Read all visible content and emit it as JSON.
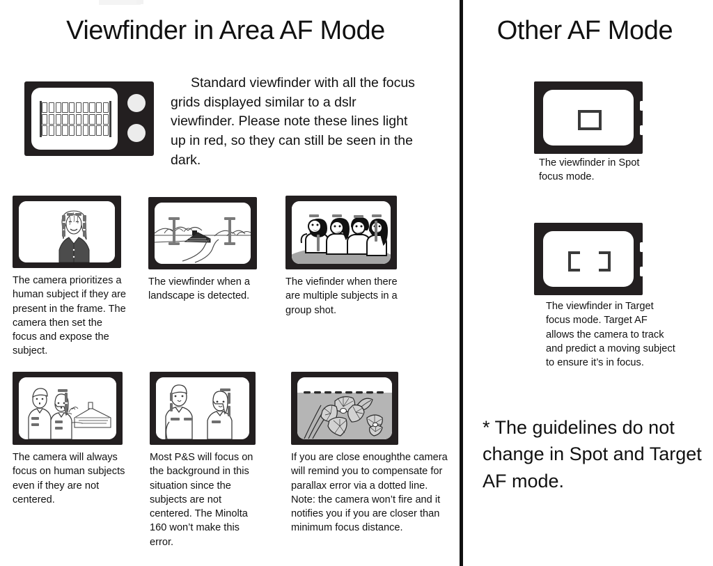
{
  "document": {
    "left_column": {
      "title": "Viewfinder in Area AF Mode",
      "intro_paragraph": "Standard viewfinder with all the focus grids displayed similar to a dslr viewfinder. Please note these lines light up in red, so they can still be seen in the dark.",
      "camera_graphic": {
        "name": "camera-lcd-with-focus-grid",
        "grid_columns": 10,
        "grid_rows": 3,
        "body_color": "#231f20",
        "screen_color": "#ffffff",
        "grid_line_color": "#4a4a4a"
      },
      "examples": [
        {
          "id": "portrait",
          "scene": "single-human-subject-portrait",
          "caption": "The camera prioritizes a human subject if they are present in the frame. The camera then set the focus and expose the subject."
        },
        {
          "id": "landscape",
          "scene": "landscape-with-hills-house-and-road",
          "caption": "The viewfinder when a landscape is detected."
        },
        {
          "id": "group",
          "scene": "group-of-four-people",
          "caption": "The viefinder when there are multiple subjects in a group shot."
        },
        {
          "id": "offcenter-couple",
          "scene": "couple-off-center-with-background-house",
          "caption": "The camera will always focus on human subjects even if they are not centered."
        },
        {
          "id": "two-subjects",
          "scene": "two-people-standing-apart",
          "caption": "Most P&S will focus on the background in this situation since the subjects are not centered. The Minolta 160 won’t make this error."
        },
        {
          "id": "macro-flowers",
          "scene": "close-up-flowers-with-parallax-dotted-line",
          "caption": "If you are close enoughthe camera will remind you to compensate for parallax error via a dotted line. Note: the camera won’t fire and it notifies you if you are closer than minimum focus distance."
        }
      ]
    },
    "right_column": {
      "title": "Other AF Mode",
      "modes": [
        {
          "id": "spot",
          "bracket_style": "narrow-pair",
          "caption": "The viewfinder in Spot focus mode."
        },
        {
          "id": "target",
          "bracket_style": "wide-pair",
          "caption": "The viewfinder in Target focus mode. Target AF allows the camera to track and predict a moving subject to ensure it’s in focus."
        }
      ],
      "footnote": "* The guidelines do not change in Spot and Target AF mode."
    },
    "colors": {
      "ink": "#111111",
      "frame": "#231f20",
      "screen": "#ffffff",
      "grid_line": "#4a4a4a",
      "bracket": "#3a3a3a",
      "shadow_gray": "#9a9a9a"
    }
  }
}
